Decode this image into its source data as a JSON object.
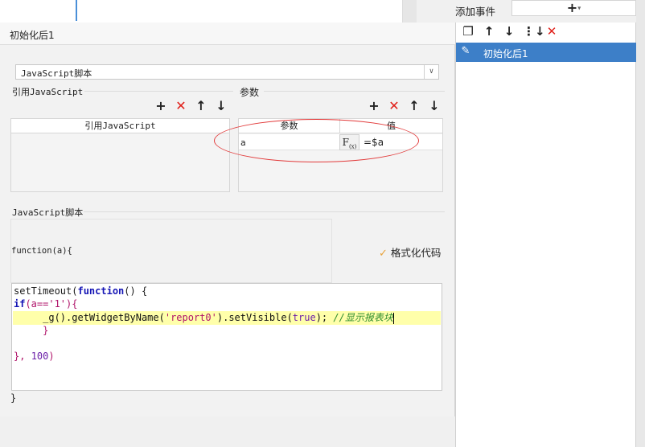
{
  "dialog": {
    "title": "初始化后1",
    "script_type_select": "JavaScript脚本"
  },
  "ref_js": {
    "group_label": "引用JavaScript",
    "column_header": "引用JavaScript"
  },
  "params": {
    "group_label": "参数",
    "col_name": "参数",
    "col_value": "值",
    "rows": [
      {
        "name": "a",
        "fx": "F",
        "value": "=$a"
      }
    ]
  },
  "script": {
    "group_label": "JavaScript脚本",
    "signature": "function(a){",
    "format_label": "格式化代码",
    "closing": "}",
    "code": {
      "l1_fn": "setTimeout(",
      "l1_kw": "function",
      "l1_rest": "() {",
      "l2_kw": "if",
      "l2_a": "(a==",
      "l2_str": "'1'",
      "l2_b": "){",
      "l3_a": "     _g().getWidgetByName(",
      "l3_str": "'report0'",
      "l3_b": ").setVisible(",
      "l3_lit": "true",
      "l3_c": "); ",
      "l3_cm": "//显示报表块",
      "l4": "     }",
      "l6_a": "}, ",
      "l6_lit": "100",
      "l6_b": ")"
    }
  },
  "right_panel": {
    "add_event_label": "添加事件",
    "events": [
      {
        "label": "初始化后1"
      }
    ]
  },
  "colors": {
    "accent": "#3d7fc8",
    "delete": "#e0201a",
    "highlight_line": "#ffffaa",
    "annotation": "#e23b3b"
  }
}
